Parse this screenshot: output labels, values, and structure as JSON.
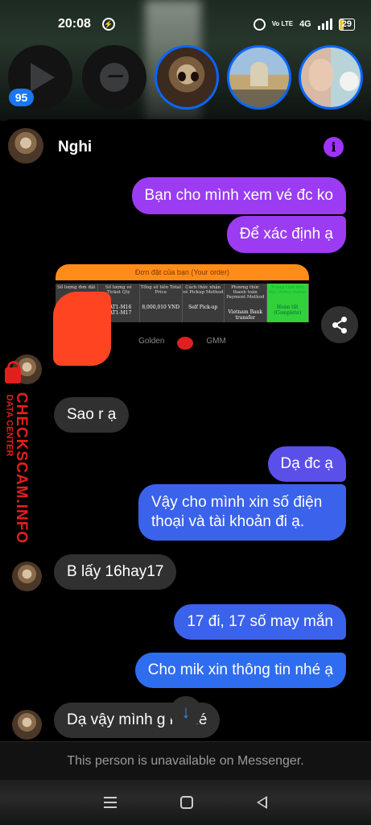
{
  "status_bar": {
    "time": "20:08",
    "network": "4G",
    "volte": "Vo LTE",
    "battery": "29"
  },
  "stories": {
    "unread_badge": "95",
    "items": [
      {
        "name": "video-story",
        "icon": "play-icon"
      },
      {
        "name": "messenger-story",
        "icon": "messenger-icon"
      },
      {
        "name": "cat-story"
      },
      {
        "name": "castle-story"
      },
      {
        "name": "duo-story"
      }
    ]
  },
  "chat": {
    "contact_name": "Nghi",
    "info_icon": "i",
    "accent_color": "#9b3cf2",
    "messages": [
      {
        "from": "me",
        "text": "Bạn cho mình xem vé đc ko"
      },
      {
        "from": "me",
        "text": "Để xác định ạ"
      },
      {
        "from": "me",
        "type": "image",
        "image": {
          "header": "Đơn đặt của bạn (Your order)",
          "columns": [
            {
              "label": "Số lượng đơn đặt",
              "value": ""
            },
            {
              "label": "Số lượng vé Ticket Qty",
              "value": "CAT1-M16 CAT1-M17"
            },
            {
              "label": "Tổng số tiền Total Price",
              "value": "8,000,010 VND"
            },
            {
              "label": "Cách thức nhận vé Pickup Method",
              "value": "Self Pick-up"
            },
            {
              "label": "Phương thức thanh toán Payment Method",
              "value": "Vietnam Bank transfer"
            },
            {
              "label": "Trạng thái đơn đặt Order status",
              "value": "Hoàn tất (Complete)"
            }
          ],
          "logos": [
            "Golden",
            "GMM"
          ]
        }
      },
      {
        "from": "them",
        "text": "Sao r ạ"
      },
      {
        "from": "me",
        "text": "Dạ đc ạ"
      },
      {
        "from": "me",
        "text_lines": [
          "Vậy cho mình xin số điện",
          "thoại và tài khoản đi ạ."
        ]
      },
      {
        "from": "them",
        "text": "B lấy 16hay17"
      },
      {
        "from": "me",
        "text": "17 đi, 17 số may mắn"
      },
      {
        "from": "me",
        "text": "Cho mik xin thông tin nhé ạ"
      },
      {
        "from": "them",
        "text": "Dạ vậy mình g     k nhé"
      }
    ]
  },
  "watermark": {
    "brand": "CHECKSCAM.INFO",
    "sub": "DATA CENTER"
  },
  "footer": {
    "unavailable_text": "This person is unavailable on Messenger."
  }
}
